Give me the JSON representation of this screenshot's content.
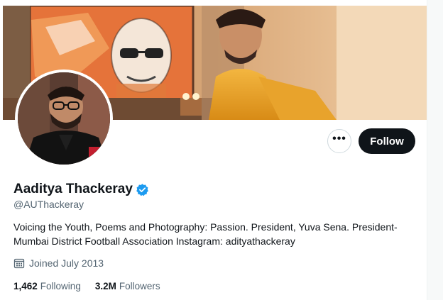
{
  "profile": {
    "display_name": "Aaditya Thackeray",
    "handle": "@AUThackeray",
    "bio": "Voicing the Youth, Poems and Photography: Passion. President, Yuva Sena. President- Mumbai District Football Association Instagram: adityathackeray",
    "joined": "Joined July 2013",
    "verified": true
  },
  "actions": {
    "more_label": "•••",
    "follow_label": "Follow"
  },
  "stats": {
    "following_count": "1,462",
    "following_label": "Following",
    "followers_count": "3.2M",
    "followers_label": "Followers"
  },
  "icons": {
    "verified": "verified-badge-icon",
    "calendar": "calendar-icon",
    "more": "more-horizontal-icon"
  },
  "colors": {
    "verified_blue": "#1d9bf0",
    "follow_bg": "#0f1419",
    "secondary_text": "#536471",
    "primary_text": "#0f1419"
  }
}
